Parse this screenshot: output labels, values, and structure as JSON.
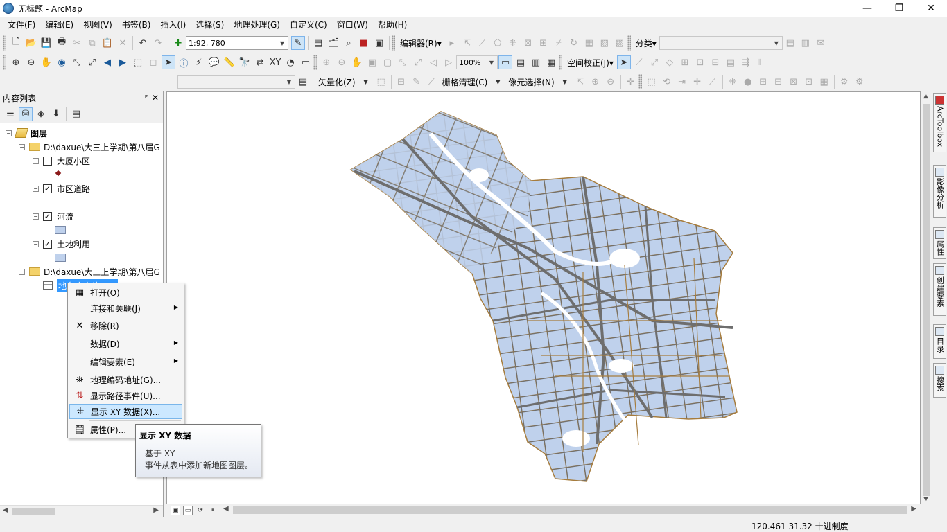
{
  "window": {
    "title": "无标题 - ArcMap",
    "minimize_glyph": "—",
    "restore_glyph": "❐",
    "close_glyph": "✕"
  },
  "menu": {
    "items": [
      "文件(F)",
      "编辑(E)",
      "视图(V)",
      "书签(B)",
      "插入(I)",
      "选择(S)",
      "地理处理(G)",
      "自定义(C)",
      "窗口(W)",
      "帮助(H)"
    ]
  },
  "toolbar1": {
    "scale": "1:92, 780",
    "editor_label": "编辑器(R)▾",
    "classify_label": "分类▾"
  },
  "toolbar2": {
    "zoom_value": "100%",
    "spatial_adjust_label": "空间校正(J)▾"
  },
  "toolbar3": {
    "vectorize_label": "矢量化(Z)",
    "raster_cleanup_label": "栅格清理(C)",
    "cell_select_label": "像元选择(N)"
  },
  "toc": {
    "title": "内容列表",
    "pin_glyph": "ᴾ",
    "close_glyph": "✕",
    "root_label": "图层",
    "group1_label": "D:\\daxue\\大三上学期\\第八届G",
    "layer1_label": "大厦小区",
    "layer1_checked": "",
    "layer2_label": "市区道路",
    "layer2_checked": "✓",
    "layer3_label": "河流",
    "layer3_checked": "✓",
    "layer4_label": "土地利用",
    "layer4_checked": "✓",
    "group2_label": "D:\\daxue\\大三上学期\\第八届G",
    "table_label": "地名库实体.csv"
  },
  "context_menu": {
    "items": [
      {
        "label": "打开(O)",
        "icon": "table-icon"
      },
      {
        "label": "连接和关联(J)",
        "icon": "",
        "submenu": true
      },
      {
        "label": "移除(R)",
        "icon": "remove-icon"
      },
      {
        "label": "数据(D)",
        "icon": "",
        "submenu": true
      },
      {
        "label": "编辑要素(E)",
        "icon": "",
        "submenu": true
      },
      {
        "label": "地理编码地址(G)...",
        "icon": "geocode-icon"
      },
      {
        "label": "显示路径事件(U)...",
        "icon": "route-event-icon"
      },
      {
        "label": "显示 XY 数据(X)...",
        "icon": "xy-data-icon",
        "hover": true
      },
      {
        "label": "属性(P)...",
        "icon": "properties-icon"
      }
    ]
  },
  "tooltip": {
    "title": "显示 XY 数据",
    "line1": "基于 XY",
    "line2": "事件从表中添加新地图图层。"
  },
  "right_dock": {
    "tabs": [
      "ArcToolbox",
      "影像分析",
      "属性",
      "创建要素",
      "目录",
      "搜索"
    ]
  },
  "status": {
    "coordinates": "120.461  31.32 十进制度"
  },
  "colors": {
    "land_fill": "#bfd1ec",
    "road_stroke": "#6e6e6e",
    "road_casing": "#a67c3d",
    "selection": "#3399ff",
    "menu_hover": "#cce8ff"
  }
}
